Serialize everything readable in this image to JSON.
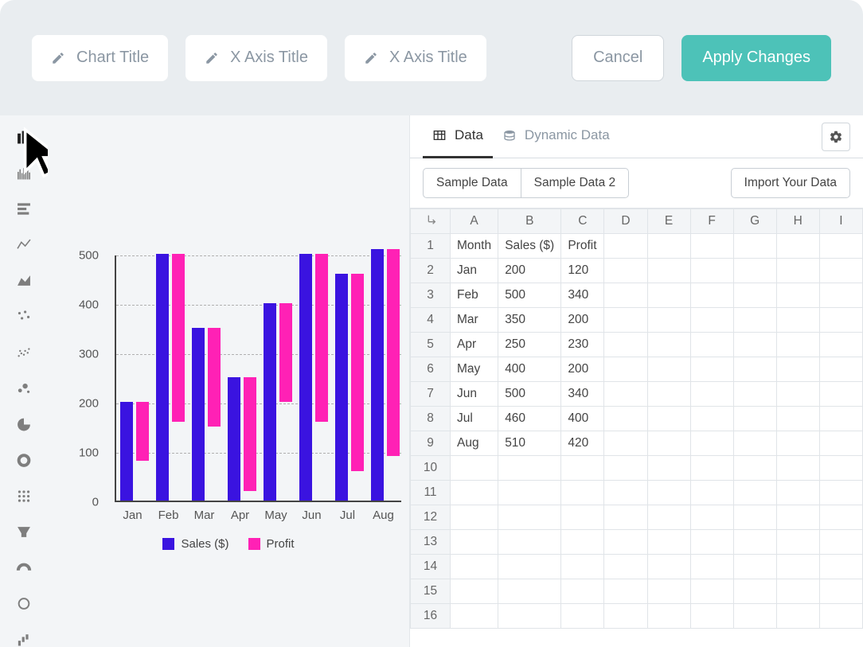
{
  "top": {
    "title_fields": [
      {
        "label": "Chart Title",
        "name": "chart-title-field"
      },
      {
        "label": "X Axis Title",
        "name": "x-axis-title-field-1"
      },
      {
        "label": "X Axis Title",
        "name": "x-axis-title-field-2"
      }
    ],
    "cancel": "Cancel",
    "apply": "Apply Changes"
  },
  "tabs": {
    "data": "Data",
    "dynamic": "Dynamic Data"
  },
  "controls": {
    "sample1": "Sample Data",
    "sample2": "Sample Data 2",
    "import": "Import Your Data"
  },
  "sheet": {
    "columns": [
      "A",
      "B",
      "C",
      "D",
      "E",
      "F",
      "G",
      "H",
      "I"
    ],
    "rows": [
      [
        "Month",
        "Sales ($)",
        "Profit",
        "",
        "",
        "",
        "",
        "",
        ""
      ],
      [
        "Jan",
        "200",
        "120",
        "",
        "",
        "",
        "",
        "",
        ""
      ],
      [
        "Feb",
        "500",
        "340",
        "",
        "",
        "",
        "",
        "",
        ""
      ],
      [
        "Mar",
        "350",
        "200",
        "",
        "",
        "",
        "",
        "",
        ""
      ],
      [
        "Apr",
        "250",
        "230",
        "",
        "",
        "",
        "",
        "",
        ""
      ],
      [
        "May",
        "400",
        "200",
        "",
        "",
        "",
        "",
        "",
        ""
      ],
      [
        "Jun",
        "500",
        "340",
        "",
        "",
        "",
        "",
        "",
        ""
      ],
      [
        "Jul",
        "460",
        "400",
        "",
        "",
        "",
        "",
        "",
        ""
      ],
      [
        "Aug",
        "510",
        "420",
        "",
        "",
        "",
        "",
        "",
        ""
      ],
      [
        "",
        "",
        "",
        "",
        "",
        "",
        "",
        "",
        ""
      ],
      [
        "",
        "",
        "",
        "",
        "",
        "",
        "",
        "",
        ""
      ],
      [
        "",
        "",
        "",
        "",
        "",
        "",
        "",
        "",
        ""
      ],
      [
        "",
        "",
        "",
        "",
        "",
        "",
        "",
        "",
        ""
      ],
      [
        "",
        "",
        "",
        "",
        "",
        "",
        "",
        "",
        ""
      ],
      [
        "",
        "",
        "",
        "",
        "",
        "",
        "",
        "",
        ""
      ],
      [
        "",
        "",
        "",
        "",
        "",
        "",
        "",
        "",
        ""
      ]
    ]
  },
  "legend": {
    "s1": "Sales ($)",
    "s2": "Profit"
  },
  "chart_data": {
    "type": "bar",
    "categories": [
      "Jan",
      "Feb",
      "Mar",
      "Apr",
      "May",
      "Jun",
      "Jul",
      "Aug"
    ],
    "series": [
      {
        "name": "Sales ($)",
        "color": "#3a13e0",
        "values": [
          200,
          500,
          350,
          250,
          400,
          500,
          460,
          510
        ]
      },
      {
        "name": "Profit",
        "color": "#ff21b5",
        "values": [
          120,
          340,
          200,
          230,
          200,
          340,
          400,
          420
        ]
      }
    ],
    "ylim": [
      0,
      500
    ],
    "yticks": [
      0,
      100,
      200,
      300,
      400,
      500
    ],
    "xlabel": "",
    "ylabel": "",
    "title": ""
  },
  "sidebar_icons": [
    "bar-chart-icon",
    "dense-bar-icon",
    "horizontal-bar-icon",
    "line-chart-icon",
    "area-chart-icon",
    "scatter-sparse-icon",
    "scatter-icon",
    "bubble-icon",
    "pie-icon",
    "donut-icon",
    "matrix-icon",
    "funnel-icon",
    "gauge-icon",
    "ring-icon",
    "waterfall-icon"
  ]
}
